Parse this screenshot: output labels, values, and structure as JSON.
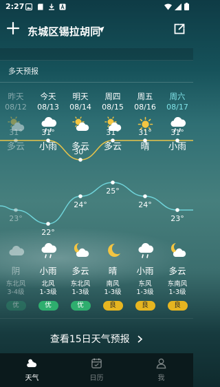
{
  "status_bar": {
    "time": "2:27"
  },
  "header": {
    "location": "东城区锡拉胡同"
  },
  "section": {
    "title": "多天预报"
  },
  "days": [
    {
      "day": "昨天",
      "date": "08/12",
      "day_condition": "多云",
      "day_icon": "partly-cloudy-icon",
      "night_condition": "阴",
      "night_icon": "cloudy-icon",
      "wind": "东北风",
      "wind_level": "3-4级",
      "aqi": "优",
      "aqi_color": "#2e8b6a",
      "high": 31,
      "low": 23,
      "high_label": "31°",
      "low_label": "23°"
    },
    {
      "day": "今天",
      "date": "08/13",
      "day_condition": "小雨",
      "day_icon": "light-rain-icon",
      "night_condition": "小雨",
      "night_icon": "light-rain-icon",
      "wind": "北风",
      "wind_level": "1-3级",
      "aqi": "优",
      "aqi_color": "#2eae6e",
      "high": 31,
      "low": 22,
      "high_label": "31°",
      "low_label": "22°"
    },
    {
      "day": "明天",
      "date": "08/14",
      "day_condition": "多云",
      "day_icon": "partly-cloudy-icon",
      "night_condition": "多云",
      "night_icon": "cloudy-night-icon",
      "wind": "东北风",
      "wind_level": "1-3级",
      "aqi": "优",
      "aqi_color": "#2eae6e",
      "high": 30,
      "low": 24,
      "high_label": "30°",
      "low_label": "24°"
    },
    {
      "day": "周四",
      "date": "08/15",
      "day_condition": "多云",
      "day_icon": "partly-cloudy-icon",
      "night_condition": "晴",
      "night_icon": "moon-icon",
      "wind": "南风",
      "wind_level": "1-3级",
      "aqi": "良",
      "aqi_color": "#e6b520",
      "high": 31,
      "low": 25,
      "high_label": "31°",
      "low_label": "25°"
    },
    {
      "day": "周五",
      "date": "08/16",
      "day_condition": "晴",
      "day_icon": "sun-icon",
      "night_condition": "小雨",
      "night_icon": "light-rain-icon",
      "wind": "东风",
      "wind_level": "1-3级",
      "aqi": "良",
      "aqi_color": "#e6b520",
      "high": 31,
      "low": 24,
      "high_label": "31°",
      "low_label": "24°"
    },
    {
      "day": "周六",
      "date": "08/17",
      "day_condition": "小雨",
      "day_icon": "light-rain-icon",
      "night_condition": "多云",
      "night_icon": "cloudy-night-icon",
      "wind": "东南风",
      "wind_level": "1-3级",
      "aqi": "良",
      "aqi_color": "#e6b520",
      "high": 31,
      "low": 23,
      "high_label": "31°",
      "low_label": "23°"
    }
  ],
  "colors": {
    "high_line": "#e9c44a",
    "low_line": "#6fd3d9",
    "accent_saturday": "#7fe3e8"
  },
  "forecast_button": {
    "label": "查看15日天气预报"
  },
  "tabs": [
    {
      "label": "天气",
      "icon": "weather-icon",
      "active": true
    },
    {
      "label": "日历",
      "icon": "calendar-icon",
      "active": false
    },
    {
      "label": "我",
      "icon": "profile-icon",
      "active": false
    }
  ]
}
